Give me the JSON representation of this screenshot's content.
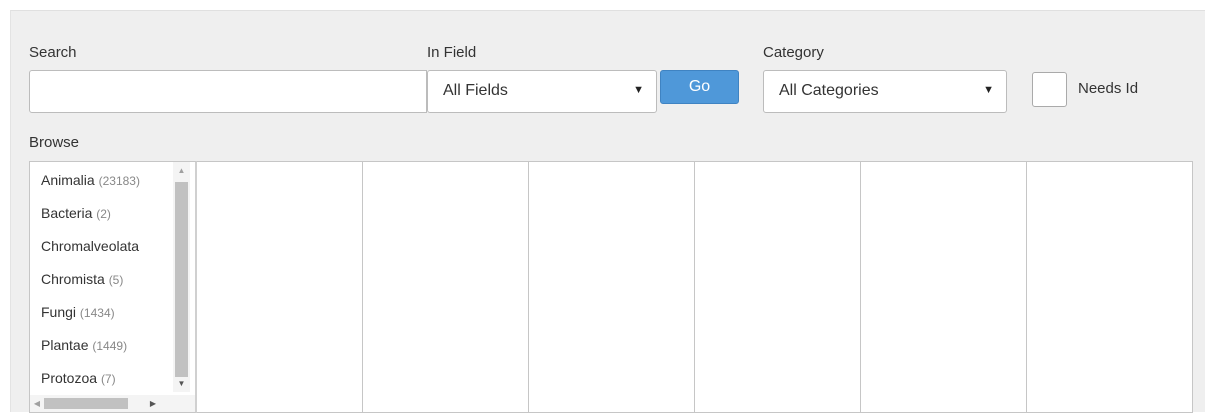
{
  "search": {
    "label": "Search",
    "value": "",
    "placeholder": ""
  },
  "in_field": {
    "label": "In Field",
    "selected": "All Fields",
    "arrow": "▼"
  },
  "go_button": {
    "label": "Go",
    "color": "#4f98d9"
  },
  "category": {
    "label": "Category",
    "selected": "All Categories",
    "arrow": "▼"
  },
  "needs_id": {
    "label": "Needs Id",
    "checked": false
  },
  "browse": {
    "label": "Browse",
    "items": [
      {
        "name": "Animalia",
        "count": "(23183)"
      },
      {
        "name": "Bacteria",
        "count": "(2)"
      },
      {
        "name": "Chromalveolata",
        "count": ""
      },
      {
        "name": "Chromista",
        "count": "(5)"
      },
      {
        "name": "Fungi",
        "count": "(1434)"
      },
      {
        "name": "Plantae",
        "count": "(1449)"
      },
      {
        "name": "Protozoa",
        "count": "(7)"
      }
    ],
    "scroll": {
      "up": "▲",
      "down": "▼",
      "left": "◀",
      "right": "▶"
    }
  }
}
